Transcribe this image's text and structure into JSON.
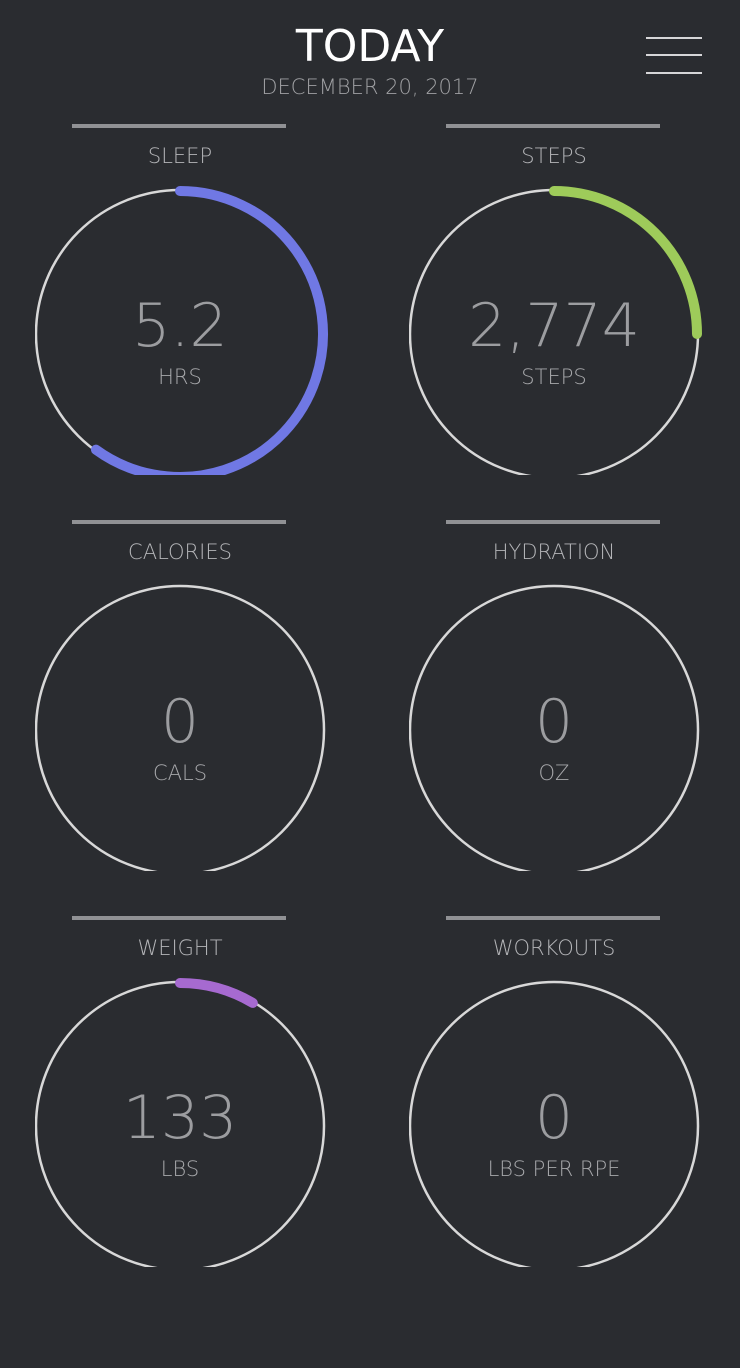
{
  "header": {
    "title": "TODAY",
    "date": "DECEMBER 20, 2017"
  },
  "menu": {
    "icon": "hamburger-menu-icon"
  },
  "colors": {
    "background": "#2a2c30",
    "ring_track": "#d8d8d8",
    "sleep": "#7078e4",
    "steps": "#9ecb5a",
    "weight": "#a66ad0"
  },
  "tiles": [
    {
      "id": "sleep",
      "label": "SLEEP",
      "value": "5.2",
      "unit": "HRS",
      "progress": 0.6,
      "color": "#7078e4"
    },
    {
      "id": "steps",
      "label": "STEPS",
      "value": "2,774",
      "unit": "STEPS",
      "progress": 0.25,
      "color": "#9ecb5a"
    },
    {
      "id": "calories",
      "label": "CALORIES",
      "value": "0",
      "unit": "CALS",
      "progress": 0,
      "color": "#7078e4"
    },
    {
      "id": "hydration",
      "label": "HYDRATION",
      "value": "0",
      "unit": "OZ",
      "progress": 0,
      "color": "#5aa0e0"
    },
    {
      "id": "weight",
      "label": "WEIGHT",
      "value": "133",
      "unit": "LBS",
      "progress": 0.085,
      "color": "#a66ad0"
    },
    {
      "id": "workouts",
      "label": "WORKOUTS",
      "value": "0",
      "unit": "LBS PER RPE",
      "progress": 0,
      "color": "#e0a040"
    }
  ]
}
